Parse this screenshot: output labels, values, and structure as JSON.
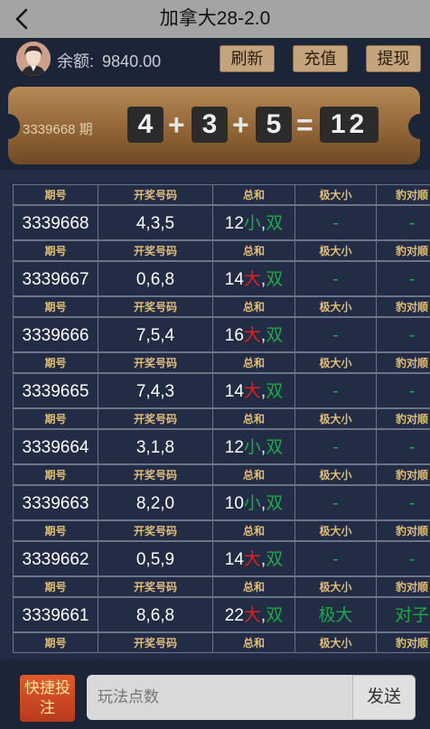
{
  "header": {
    "title": "加拿大28-2.0"
  },
  "user": {
    "balance_label": "余额:",
    "balance_value": "9840.00"
  },
  "actions": {
    "refresh": "刷新",
    "recharge": "充值",
    "withdraw": "提现"
  },
  "latest": {
    "issue": "3339668 期",
    "digits": [
      "4",
      "3",
      "5"
    ],
    "plus": "+",
    "equals": "=",
    "sum": "12"
  },
  "table": {
    "headers": [
      "期号",
      "开奖号码",
      "总和",
      "极大小",
      "豹对顺"
    ],
    "rows": [
      {
        "issue": "3339668",
        "numbers": "4,3,5",
        "sum": "12",
        "size": "小",
        "comma": ",",
        "parity": "双",
        "extreme": "-",
        "combo": "-"
      },
      {
        "issue": "3339667",
        "numbers": "0,6,8",
        "sum": "14",
        "size": "大",
        "comma": ",",
        "parity": "双",
        "extreme": "-",
        "combo": "-"
      },
      {
        "issue": "3339666",
        "numbers": "7,5,4",
        "sum": "16",
        "size": "大",
        "comma": ",",
        "parity": "双",
        "extreme": "-",
        "combo": "-"
      },
      {
        "issue": "3339665",
        "numbers": "7,4,3",
        "sum": "14",
        "size": "大",
        "comma": ",",
        "parity": "双",
        "extreme": "-",
        "combo": "-"
      },
      {
        "issue": "3339664",
        "numbers": "3,1,8",
        "sum": "12",
        "size": "小",
        "comma": ",",
        "parity": "双",
        "extreme": "-",
        "combo": "-"
      },
      {
        "issue": "3339663",
        "numbers": "8,2,0",
        "sum": "10",
        "size": "小",
        "comma": ",",
        "parity": "双",
        "extreme": "-",
        "combo": "-"
      },
      {
        "issue": "3339662",
        "numbers": "0,5,9",
        "sum": "14",
        "size": "大",
        "comma": ",",
        "parity": "双",
        "extreme": "-",
        "combo": "-"
      },
      {
        "issue": "3339661",
        "numbers": "8,6,8",
        "sum": "22",
        "size": "大",
        "comma": ",",
        "parity": "双",
        "extreme": "极大",
        "combo": "对子"
      }
    ]
  },
  "footer": {
    "quick_bet": "快捷投注",
    "input_placeholder": "玩法点数",
    "send": "发送"
  },
  "colors": {
    "big": "#e02020",
    "small": "#1fa84a",
    "gold": "#e0bd7a",
    "ticket": "#9a6d3c",
    "quick_bet": "#d04a22"
  },
  "icons": {
    "back": "chevron-left-icon",
    "avatar": "avatar"
  }
}
